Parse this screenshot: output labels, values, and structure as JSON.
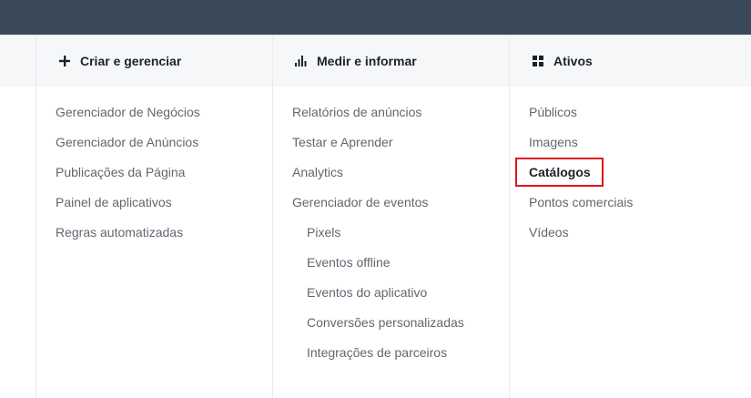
{
  "columns": [
    {
      "title": "Criar e gerenciar",
      "icon": "plus-icon",
      "items": [
        {
          "label": "Gerenciador de Negócios"
        },
        {
          "label": "Gerenciador de Anúncios"
        },
        {
          "label": "Publicações da Página"
        },
        {
          "label": "Painel de aplicativos"
        },
        {
          "label": "Regras automatizadas"
        }
      ]
    },
    {
      "title": "Medir e informar",
      "icon": "bar-chart-icon",
      "items": [
        {
          "label": "Relatórios de anúncios"
        },
        {
          "label": "Testar e Aprender"
        },
        {
          "label": "Analytics"
        },
        {
          "label": "Gerenciador de eventos"
        },
        {
          "label": "Pixels"
        },
        {
          "label": "Eventos offline"
        },
        {
          "label": "Eventos do aplicativo"
        },
        {
          "label": "Conversões personalizadas"
        },
        {
          "label": "Integrações de parceiros"
        }
      ]
    },
    {
      "title": "Ativos",
      "icon": "grid-icon",
      "items": [
        {
          "label": "Públicos"
        },
        {
          "label": "Imagens"
        },
        {
          "label": "Catálogos"
        },
        {
          "label": "Pontos comerciais"
        },
        {
          "label": "Vídeos"
        }
      ]
    }
  ],
  "colors": {
    "topbar": "#3b4859",
    "header_band": "#f6f7f9",
    "highlight_border": "#e0151b",
    "text_muted": "#606770",
    "text_strong": "#1d2129"
  }
}
